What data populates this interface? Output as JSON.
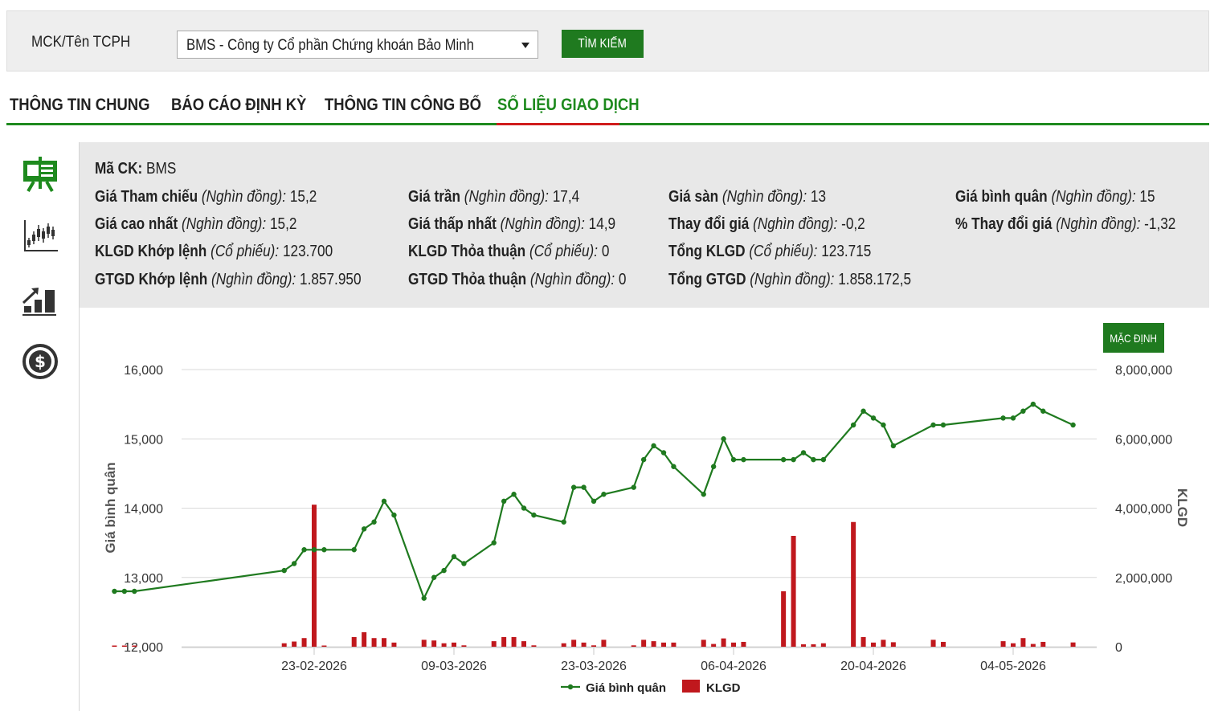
{
  "search": {
    "label": "MCK/Tên TCPH",
    "selected_value": "BMS - Công ty Cổ phần Chứng khoán Bảo Minh",
    "button_label": "TÌM KIẾM"
  },
  "tabs": [
    {
      "label": "THÔNG TIN CHUNG",
      "active": false
    },
    {
      "label": "BÁO CÁO ĐỊNH KỲ",
      "active": false
    },
    {
      "label": "THÔNG TIN CÔNG BỐ",
      "active": false
    },
    {
      "label": "SỐ LIỆU GIAO DỊCH",
      "active": true
    }
  ],
  "sidebar": {
    "icons": [
      "presentation-board-icon",
      "candlestick-chart-icon",
      "bar-growth-chart-icon",
      "dollar-coin-icon"
    ]
  },
  "info": {
    "ticker": {
      "label": "Mã CK:",
      "value": " BMS"
    },
    "rows": [
      [
        {
          "label": "Giá Tham chiếu",
          "unit": " (Nghìn đồng):",
          "value": " 15,2"
        },
        {
          "label": "Giá trần",
          "unit": " (Nghìn đồng):",
          "value": " 17,4"
        },
        {
          "label": "Giá sàn",
          "unit": " (Nghìn đồng):",
          "value": " 13"
        },
        {
          "label": "Giá bình quân",
          "unit": " (Nghìn đồng):",
          "value": " 15"
        }
      ],
      [
        {
          "label": "Giá cao nhất",
          "unit": " (Nghìn đồng):",
          "value": " 15,2"
        },
        {
          "label": "Giá thấp nhất",
          "unit": " (Nghìn đồng):",
          "value": " 14,9"
        },
        {
          "label": "Thay đổi giá",
          "unit": " (Nghìn đồng):",
          "value": " -0,2"
        },
        {
          "label": "% Thay đổi giá",
          "unit": " (Nghìn đồng):",
          "value": " -1,32"
        }
      ],
      [
        {
          "label": "KLGD Khớp lệnh",
          "unit": " (Cổ phiếu):",
          "value": " 123.700"
        },
        {
          "label": "KLGD Thỏa thuận",
          "unit": " (Cổ phiếu):",
          "value": " 0"
        },
        {
          "label": "Tổng KLGD",
          "unit": " (Cổ phiếu):",
          "value": " 123.715"
        }
      ],
      [
        {
          "label": "GTGD Khớp lệnh",
          "unit": " (Nghìn đồng):",
          "value": " 1.857.950"
        },
        {
          "label": "GTGD Thỏa thuận",
          "unit": " (Nghìn đồng):",
          "value": " 0"
        },
        {
          "label": "Tổng GTGD",
          "unit": " (Nghìn đồng):",
          "value": " 1.858.172,5"
        }
      ]
    ]
  },
  "chart_controls": {
    "default_button": "MẶC ĐỊNH"
  },
  "chart_data": {
    "type": "line+bar",
    "x_tick_labels": [
      "23-02-2026",
      "09-03-2026",
      "23-03-2026",
      "06-04-2026",
      "20-04-2026",
      "04-05-2026"
    ],
    "x_tick_dates": [
      "2026-02-23",
      "2026-03-09",
      "2026-03-23",
      "2026-04-06",
      "2026-04-20",
      "2026-05-04"
    ],
    "y_left": {
      "label": "Giá bình quân",
      "range": [
        12000,
        16000
      ],
      "ticks": [
        12000,
        13000,
        14000,
        15000,
        16000
      ],
      "tick_labels": [
        "12,000",
        "13,000",
        "14,000",
        "15,000",
        "16,000"
      ]
    },
    "y_right": {
      "label": "KLGD",
      "range": [
        0,
        8000000
      ],
      "ticks": [
        0,
        2000000,
        4000000,
        6000000,
        8000000
      ],
      "tick_labels": [
        "0",
        "2,000,000",
        "4,000,000",
        "6,000,000",
        "8,000,000"
      ]
    },
    "grid": true,
    "legend_position": "bottom-center",
    "series": [
      {
        "name": "Giá bình quân",
        "type": "line",
        "color": "#1f7a1f",
        "axis": "left"
      },
      {
        "name": "KLGD",
        "type": "bar",
        "color": "#c0181d",
        "axis": "right"
      }
    ],
    "points": [
      {
        "date": "2026-02-03",
        "price": 12800,
        "volume": 20000
      },
      {
        "date": "2026-02-04",
        "price": 12800,
        "volume": 20000
      },
      {
        "date": "2026-02-05",
        "price": 12800,
        "volume": 20000
      },
      {
        "date": "2026-02-20",
        "price": 13100,
        "volume": 100000
      },
      {
        "date": "2026-02-21",
        "price": 13200,
        "volume": 150000
      },
      {
        "date": "2026-02-22",
        "price": 13400,
        "volume": 250000
      },
      {
        "date": "2026-02-23",
        "price": 13400,
        "volume": 4100000
      },
      {
        "date": "2026-02-24",
        "price": 13400,
        "volume": 30000
      },
      {
        "date": "2026-02-27",
        "price": 13400,
        "volume": 280000
      },
      {
        "date": "2026-02-28",
        "price": 13700,
        "volume": 420000
      },
      {
        "date": "2026-03-01",
        "price": 13800,
        "volume": 250000
      },
      {
        "date": "2026-03-02",
        "price": 14100,
        "volume": 250000
      },
      {
        "date": "2026-03-03",
        "price": 13900,
        "volume": 120000
      },
      {
        "date": "2026-03-06",
        "price": 12700,
        "volume": 200000
      },
      {
        "date": "2026-03-07",
        "price": 13000,
        "volume": 180000
      },
      {
        "date": "2026-03-08",
        "price": 13100,
        "volume": 100000
      },
      {
        "date": "2026-03-09",
        "price": 13300,
        "volume": 120000
      },
      {
        "date": "2026-03-10",
        "price": 13200,
        "volume": 40000
      },
      {
        "date": "2026-03-13",
        "price": 13500,
        "volume": 160000
      },
      {
        "date": "2026-03-14",
        "price": 14100,
        "volume": 280000
      },
      {
        "date": "2026-03-15",
        "price": 14200,
        "volume": 280000
      },
      {
        "date": "2026-03-16",
        "price": 14000,
        "volume": 160000
      },
      {
        "date": "2026-03-17",
        "price": 13900,
        "volume": 40000
      },
      {
        "date": "2026-03-20",
        "price": 13800,
        "volume": 100000
      },
      {
        "date": "2026-03-21",
        "price": 14300,
        "volume": 200000
      },
      {
        "date": "2026-03-22",
        "price": 14300,
        "volume": 120000
      },
      {
        "date": "2026-03-23",
        "price": 14100,
        "volume": 40000
      },
      {
        "date": "2026-03-24",
        "price": 14200,
        "volume": 200000
      },
      {
        "date": "2026-03-27",
        "price": 14300,
        "volume": 40000
      },
      {
        "date": "2026-03-28",
        "price": 14700,
        "volume": 200000
      },
      {
        "date": "2026-03-29",
        "price": 14900,
        "volume": 160000
      },
      {
        "date": "2026-03-30",
        "price": 14800,
        "volume": 120000
      },
      {
        "date": "2026-03-31",
        "price": 14600,
        "volume": 120000
      },
      {
        "date": "2026-04-03",
        "price": 14200,
        "volume": 200000
      },
      {
        "date": "2026-04-04",
        "price": 14600,
        "volume": 80000
      },
      {
        "date": "2026-04-05",
        "price": 15000,
        "volume": 240000
      },
      {
        "date": "2026-04-06",
        "price": 14700,
        "volume": 120000
      },
      {
        "date": "2026-04-07",
        "price": 14700,
        "volume": 140000
      },
      {
        "date": "2026-04-11",
        "price": 14700,
        "volume": 1600000
      },
      {
        "date": "2026-04-12",
        "price": 14700,
        "volume": 3200000
      },
      {
        "date": "2026-04-13",
        "price": 14800,
        "volume": 70000
      },
      {
        "date": "2026-04-14",
        "price": 14700,
        "volume": 70000
      },
      {
        "date": "2026-04-15",
        "price": 14700,
        "volume": 100000
      },
      {
        "date": "2026-04-18",
        "price": 15200,
        "volume": 3600000
      },
      {
        "date": "2026-04-19",
        "price": 15400,
        "volume": 280000
      },
      {
        "date": "2026-04-20",
        "price": 15300,
        "volume": 120000
      },
      {
        "date": "2026-04-21",
        "price": 15200,
        "volume": 200000
      },
      {
        "date": "2026-04-22",
        "price": 14900,
        "volume": 130000
      },
      {
        "date": "2026-04-26",
        "price": 15200,
        "volume": 200000
      },
      {
        "date": "2026-04-27",
        "price": 15200,
        "volume": 140000
      },
      {
        "date": "2026-05-03",
        "price": 15300,
        "volume": 160000
      },
      {
        "date": "2026-05-04",
        "price": 15300,
        "volume": 100000
      },
      {
        "date": "2026-05-05",
        "price": 15400,
        "volume": 250000
      },
      {
        "date": "2026-05-06",
        "price": 15500,
        "volume": 80000
      },
      {
        "date": "2026-05-07",
        "price": 15400,
        "volume": 140000
      },
      {
        "date": "2026-05-10",
        "price": 15200,
        "volume": 123715
      }
    ]
  }
}
